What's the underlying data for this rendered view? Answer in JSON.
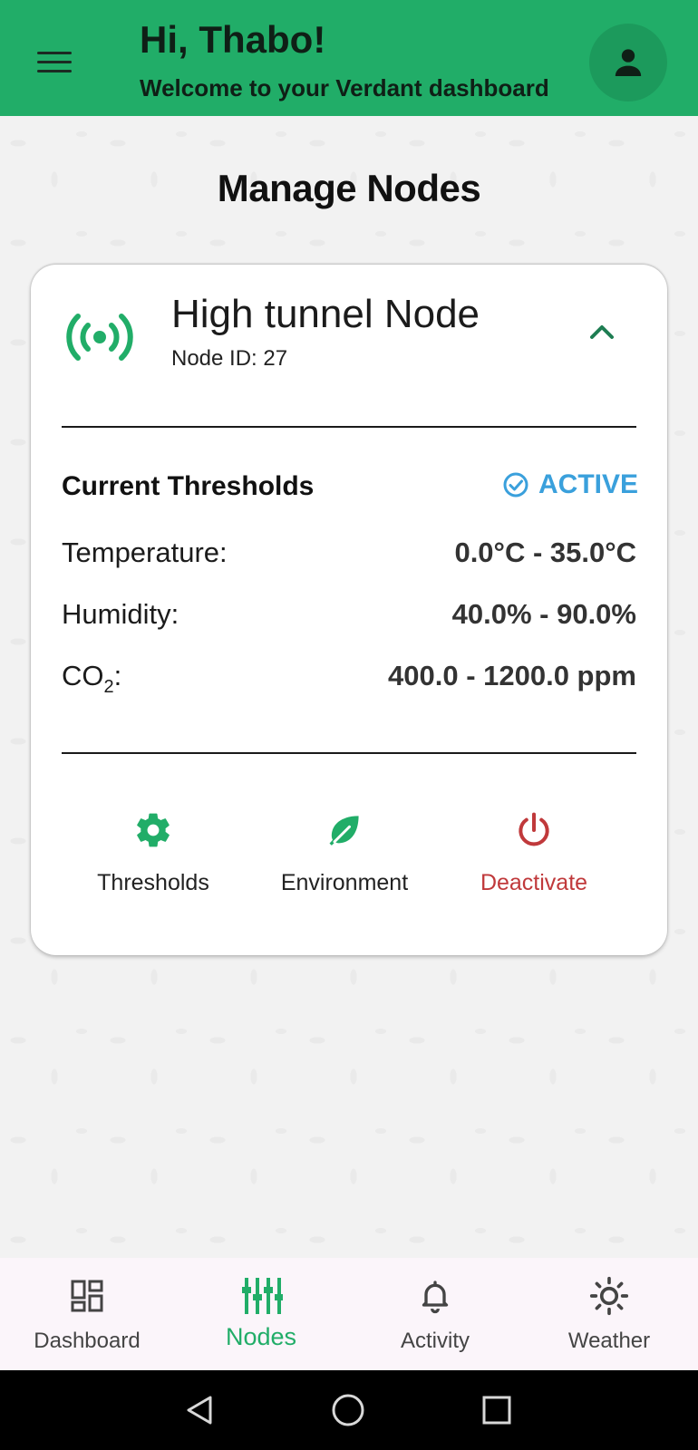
{
  "header": {
    "greeting": "Hi, Thabo!",
    "subtitle": "Welcome to your Verdant dashboard",
    "icons": {
      "menu": "hamburger-menu-icon",
      "profile": "person-icon"
    }
  },
  "page": {
    "title": "Manage Nodes"
  },
  "node_card": {
    "name": "High tunnel Node",
    "node_id": "Node ID: 27",
    "icon": "radio-signal-icon",
    "thresholds": {
      "title": "Current Thresholds",
      "status": "ACTIVE",
      "rows": [
        {
          "label": "Temperature:",
          "value": "0.0°C - 35.0°C"
        },
        {
          "label": "Humidity:",
          "value": "40.0% - 90.0%"
        },
        {
          "label_main": "CO",
          "label_sub": "2",
          "label_tail": ":",
          "value": "400.0 - 1200.0 ppm"
        }
      ]
    },
    "actions": [
      {
        "label": "Thresholds",
        "icon": "gear-icon"
      },
      {
        "label": "Environment",
        "icon": "leaf-icon"
      },
      {
        "label": "Deactivate",
        "icon": "power-icon"
      }
    ]
  },
  "bottom_nav": {
    "items": [
      {
        "label": "Dashboard",
        "icon": "dashboard-icon"
      },
      {
        "label": "Nodes",
        "icon": "nodes-icon",
        "active": true
      },
      {
        "label": "Activity",
        "icon": "bell-icon"
      },
      {
        "label": "Weather",
        "icon": "sun-icon"
      }
    ]
  },
  "colors": {
    "primary": "#21ad68",
    "status_active": "#3aa0dc",
    "danger": "#c0393b"
  }
}
